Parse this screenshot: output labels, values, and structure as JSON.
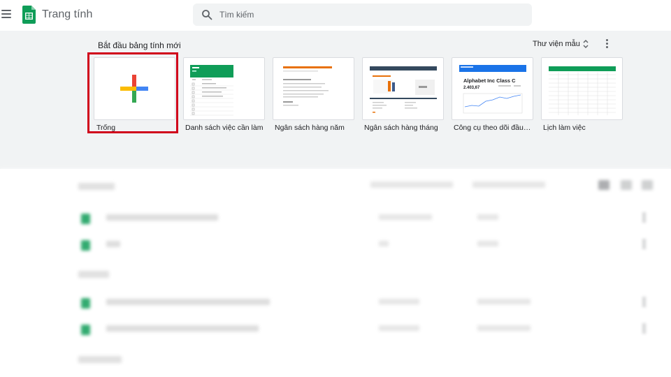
{
  "header": {
    "app_title": "Trang tính",
    "search_placeholder": "Tìm kiếm"
  },
  "gallery": {
    "title": "Bắt đầu bảng tính mới",
    "library_label": "Thư viện mẫu",
    "templates": [
      {
        "label": "Trống"
      },
      {
        "label": "Danh sách việc cần làm"
      },
      {
        "label": "Ngân sách hàng năm"
      },
      {
        "label": "Ngân sách hàng tháng"
      },
      {
        "label": "Công cụ theo dõi đầu t..."
      },
      {
        "label": "Lịch làm việc"
      }
    ],
    "stock_thumb": {
      "title": "Alphabet Inc Class C",
      "price": "2.403,67"
    }
  },
  "colors": {
    "sheets_green": "#0f9d58",
    "gallery_bg": "#f1f3f4",
    "highlight": "#d0021b",
    "plus_blue": "#4285f4",
    "plus_red": "#ea4335",
    "plus_yellow": "#fbbc04",
    "plus_green": "#34a853"
  },
  "icons": [
    "menu-icon",
    "sheets-logo-icon",
    "search-icon",
    "sort-icon",
    "more-vert-icon",
    "plus-icon"
  ]
}
